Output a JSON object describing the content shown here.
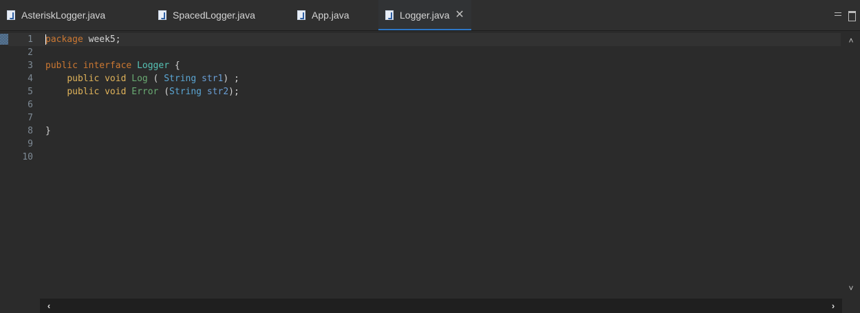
{
  "tabs": [
    {
      "label": "AsteriskLogger.java",
      "active": false
    },
    {
      "label": "SpacedLogger.java",
      "active": false
    },
    {
      "label": "App.java",
      "active": false
    },
    {
      "label": "Logger.java",
      "active": true
    }
  ],
  "icons": {
    "tab_file": "java-file-icon",
    "tab_close": "close-icon",
    "minimize": "minimize-icon",
    "maximize": "maximize-icon",
    "scroll_up": "chevron-up-icon",
    "scroll_down": "chevron-down-icon",
    "scroll_left": "chevron-left-icon",
    "scroll_right": "chevron-right-icon"
  },
  "editor": {
    "line_numbers": [
      "1",
      "2",
      "3",
      "4",
      "5",
      "6",
      "7",
      "8",
      "9",
      "10"
    ],
    "lines": [
      {
        "tokens": [
          [
            "kw",
            "package"
          ],
          [
            "plain",
            " week5;"
          ]
        ]
      },
      {
        "tokens": []
      },
      {
        "tokens": [
          [
            "kw",
            "public"
          ],
          [
            "plain",
            " "
          ],
          [
            "kw",
            "interface"
          ],
          [
            "plain",
            " "
          ],
          [
            "iface",
            "Logger"
          ],
          [
            "plain",
            " {"
          ]
        ]
      },
      {
        "tokens": [
          [
            "plain",
            "    "
          ],
          [
            "kw2",
            "public"
          ],
          [
            "plain",
            " "
          ],
          [
            "kw2",
            "void"
          ],
          [
            "plain",
            " "
          ],
          [
            "meth",
            "Log"
          ],
          [
            "plain",
            " ( "
          ],
          [
            "cls",
            "String"
          ],
          [
            "plain",
            " "
          ],
          [
            "param",
            "str1"
          ],
          [
            "plain",
            ") ;"
          ]
        ]
      },
      {
        "tokens": [
          [
            "plain",
            "    "
          ],
          [
            "kw2",
            "public"
          ],
          [
            "plain",
            " "
          ],
          [
            "kw2",
            "void"
          ],
          [
            "plain",
            " "
          ],
          [
            "meth",
            "Error"
          ],
          [
            "plain",
            " ("
          ],
          [
            "cls",
            "String"
          ],
          [
            "plain",
            " "
          ],
          [
            "param",
            "str2"
          ],
          [
            "plain",
            ");"
          ]
        ]
      },
      {
        "tokens": []
      },
      {
        "tokens": []
      },
      {
        "tokens": [
          [
            "plain",
            "}"
          ]
        ]
      },
      {
        "tokens": []
      },
      {
        "tokens": []
      }
    ]
  },
  "colors": {
    "background": "#2b2b2b",
    "keyword": "#cc7832",
    "method": "#6aab73",
    "type": "#5ba6d4",
    "interface_name": "#56c3b6",
    "active_tab_underline": "#2e78c8"
  }
}
